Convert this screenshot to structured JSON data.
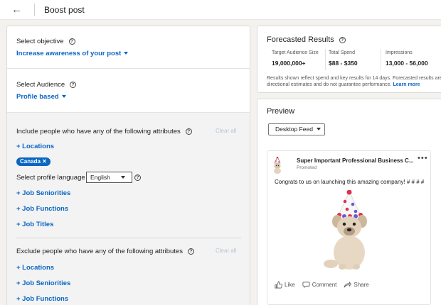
{
  "header": {
    "title": "Boost post"
  },
  "objective": {
    "label": "Select objective",
    "value": "Increase awareness of your post"
  },
  "audience": {
    "label": "Select Audience",
    "value": "Profile based"
  },
  "include": {
    "heading": "Include people who have any of the following attributes",
    "clear": "Clear all",
    "locations": "+ Locations",
    "chip": "Canada",
    "language_label": "Select profile language",
    "language_value": "English",
    "seniorities": "+ Job Seniorities",
    "functions": "+ Job Functions",
    "titles": "+ Job Titles"
  },
  "exclude": {
    "heading": "Exclude people who have any of the following attributes",
    "clear": "Clear all",
    "locations": "+ Locations",
    "seniorities": "+ Job Seniorities",
    "functions": "+ Job Functions"
  },
  "forecast": {
    "title": "Forecasted Results",
    "stats": [
      {
        "label": "Target Audience Size",
        "value": "19,000,000+"
      },
      {
        "label": "Total Spend",
        "value": "$88 - $350"
      },
      {
        "label": "Impressions",
        "value": "13,000 - 56,000"
      }
    ],
    "disclaimer": "Results shown reflect spend and key results for 14 days. Forecasted results are directional estimates and do not guarantee performance.",
    "learn_more": "Learn more"
  },
  "preview": {
    "title": "Preview",
    "feed_select": "Desktop Feed",
    "post": {
      "author": "Super Important Professional Business C...",
      "meta": "Promoted",
      "text": "Congrats to us on launching this amazing company! # # # #",
      "actions": {
        "like": "Like",
        "comment": "Comment",
        "share": "Share"
      }
    }
  },
  "colors": {
    "accent": "#0a66c2",
    "page_bg": "#f3f2ef"
  },
  "icons": {
    "back": "arrow-left-icon",
    "help": "question-circle-icon",
    "more": "ellipsis-icon"
  }
}
